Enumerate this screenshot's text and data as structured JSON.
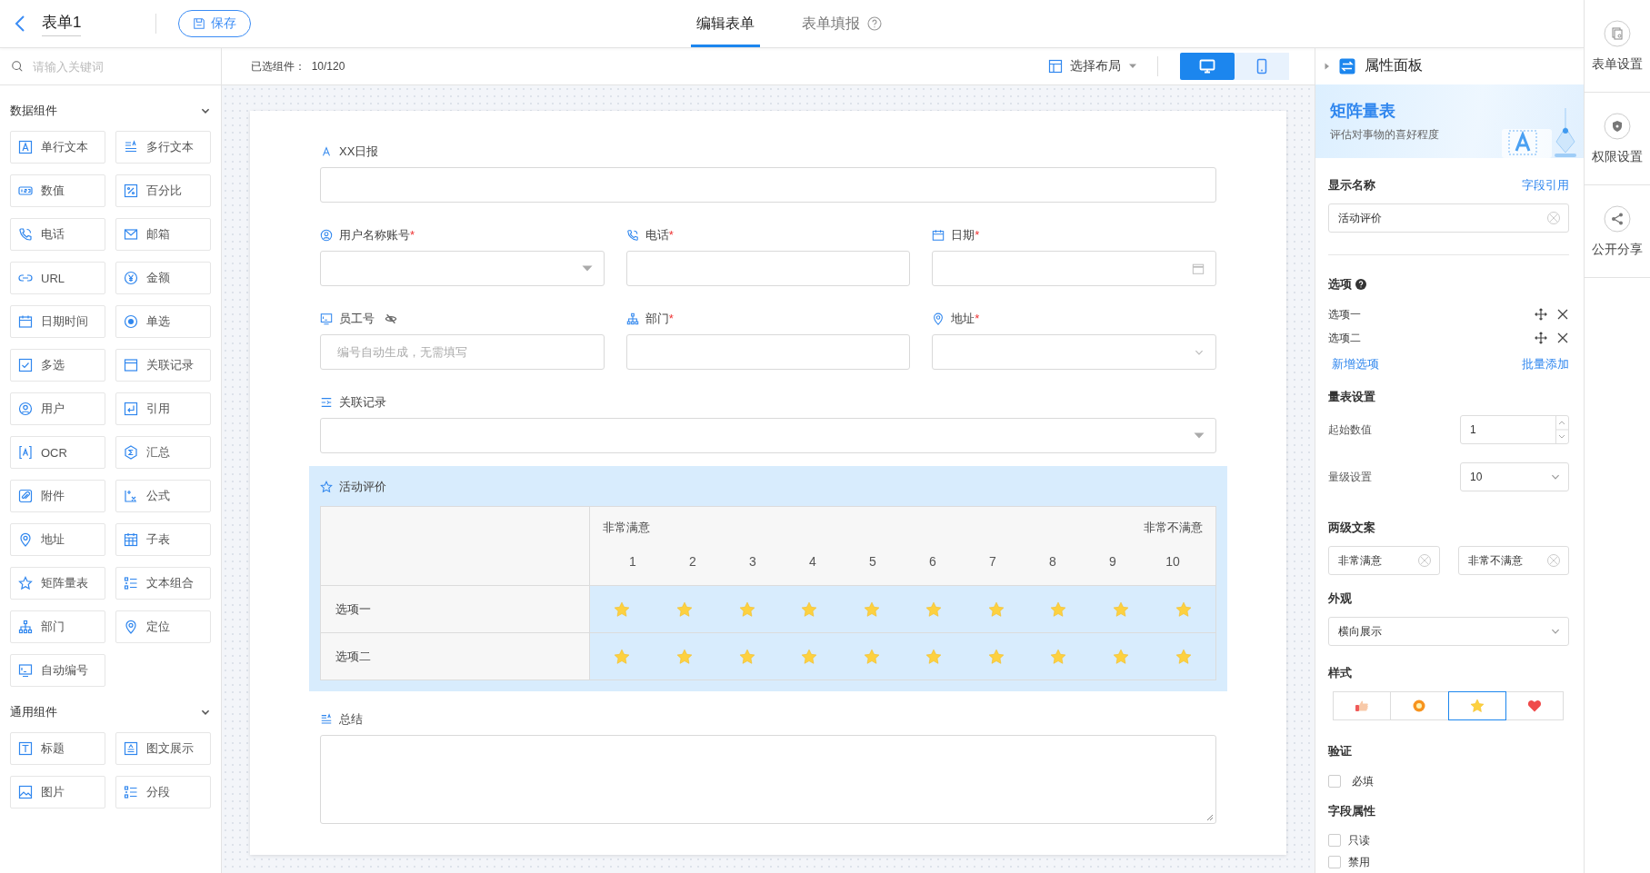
{
  "header": {
    "title": "表单1",
    "save_button": "保存",
    "tabs": [
      {
        "label": "编辑表单",
        "selected": true,
        "help": false
      },
      {
        "label": "表单填报",
        "selected": false,
        "help": true
      }
    ]
  },
  "sidebar": {
    "search": {
      "placeholder": "请输入关键词"
    },
    "groups": [
      {
        "title": "数据组件",
        "expanded": true,
        "items": [
          "单行文本",
          "多行文本",
          "数值",
          "百分比",
          "电话",
          "邮箱",
          "URL",
          "金额",
          "日期时间",
          "单选",
          "多选",
          "关联记录",
          "用户",
          "引用",
          "OCR",
          "汇总",
          "附件",
          "公式",
          "地址",
          "子表",
          "矩阵量表",
          "文本组合",
          "部门",
          "定位",
          "自动编号"
        ]
      },
      {
        "title": "通用组件",
        "expanded": true,
        "items": [
          "标题",
          "图文展示",
          "图片",
          "分段"
        ]
      }
    ]
  },
  "toolbar": {
    "selected_label": "已选组件：",
    "selected_count": "10/120",
    "layout_button": "选择布局",
    "devices": [
      {
        "kind": "desktop",
        "selected": true
      },
      {
        "kind": "mobile",
        "selected": false
      }
    ]
  },
  "form": {
    "rows": [
      {
        "fields": [
          {
            "kind": "text",
            "label": "XX日报",
            "selected": false,
            "hidden": false
          }
        ]
      },
      {
        "fields": [
          {
            "kind": "select",
            "label": "用户名称账号",
            "required_mark": "*",
            "selected": false,
            "hidden": false
          },
          {
            "kind": "text",
            "label": "电话",
            "required_mark": "*",
            "selected": false,
            "hidden": false
          },
          {
            "kind": "date",
            "label": "日期",
            "required_mark": "*",
            "selected": false,
            "hidden": false
          }
        ]
      },
      {
        "fields": [
          {
            "kind": "auto",
            "label": "员工号",
            "placeholder": "编号自动生成，无需填写",
            "selected": false,
            "hidden": true
          },
          {
            "kind": "text",
            "label": "部门",
            "required_mark": "*",
            "selected": false,
            "hidden": false
          },
          {
            "kind": "dropdown",
            "label": "地址",
            "required_mark": "*",
            "selected": false,
            "hidden": false
          }
        ]
      },
      {
        "fields": [
          {
            "kind": "select",
            "label": "关联记录",
            "selected": false,
            "hidden": false
          }
        ]
      },
      {
        "fields": [
          {
            "kind": "matrix",
            "label": "活动评价",
            "selected": true,
            "low_label": "非常满意",
            "high_label": "非常不满意",
            "scale": [
              "1",
              "2",
              "3",
              "4",
              "5",
              "6",
              "7",
              "8",
              "9",
              "10"
            ],
            "rows": [
              "选项一",
              "选项二"
            ]
          }
        ]
      },
      {
        "fields": [
          {
            "kind": "textarea",
            "label": "总结",
            "selected": false,
            "hidden": false
          }
        ]
      }
    ]
  },
  "property_panel": {
    "title": "属性面板",
    "banner": {
      "title": "矩阵量表",
      "subtitle": "评估对事物的喜好程度"
    },
    "display_name": {
      "label": "显示名称",
      "link": "字段引用",
      "value": "活动评价"
    },
    "options": {
      "label": "选项",
      "items": [
        "选项一",
        "选项二"
      ],
      "add_link": "新增选项",
      "batch_link": "批量添加"
    },
    "scale_settings": {
      "label": "量表设置",
      "start_label": "起始数值",
      "start_value": "1",
      "levels_label": "量级设置",
      "levels_value": "10"
    },
    "texts": {
      "label": "两级文案",
      "low": "非常满意",
      "high": "非常不满意"
    },
    "appearance": {
      "label": "外观",
      "value": "横向展示"
    },
    "style": {
      "label": "样式",
      "choices": [
        {
          "kind": "thumb",
          "selected": false
        },
        {
          "kind": "ring",
          "selected": false
        },
        {
          "kind": "star",
          "selected": true
        },
        {
          "kind": "heart",
          "selected": false
        }
      ]
    },
    "validation": {
      "label": "验证",
      "checks": [
        {
          "label": "必填",
          "checked": false
        }
      ]
    },
    "field_attributes": {
      "label": "字段属性",
      "checks": [
        {
          "label": "只读",
          "checked": false
        },
        {
          "label": "禁用",
          "checked": false
        }
      ]
    }
  },
  "right_rail": [
    "表单设置",
    "权限设置",
    "公开分享"
  ]
}
